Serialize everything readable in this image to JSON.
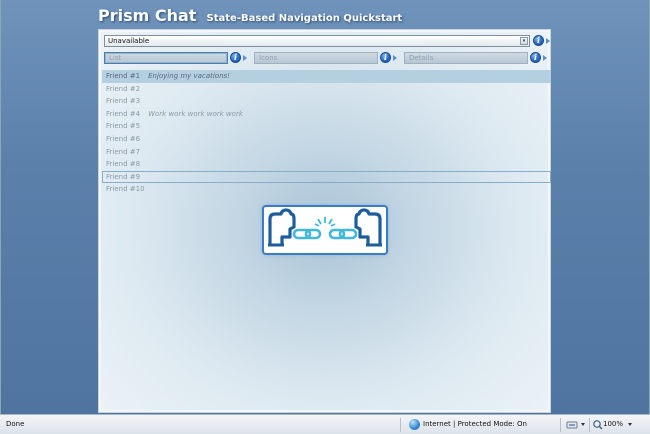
{
  "app": {
    "title": "Prism Chat",
    "subtitle": "State-Based Navigation Quickstart"
  },
  "status_select": {
    "value": "Unavailable",
    "arrow": "▾"
  },
  "tabs": [
    {
      "label": "List",
      "active": true
    },
    {
      "label": "Icons",
      "active": false
    },
    {
      "label": "Details",
      "active": false
    }
  ],
  "info_glyph": "i",
  "friends": [
    {
      "name": "Friend #1",
      "status": "Enjoying my vacations!",
      "selected": true,
      "focused": false
    },
    {
      "name": "Friend #2",
      "status": "",
      "selected": false,
      "focused": false
    },
    {
      "name": "Friend #3",
      "status": "",
      "selected": false,
      "focused": false
    },
    {
      "name": "Friend #4",
      "status": "Work work work work work",
      "selected": false,
      "focused": false
    },
    {
      "name": "Friend #5",
      "status": "",
      "selected": false,
      "focused": false
    },
    {
      "name": "Friend #6",
      "status": "",
      "selected": false,
      "focused": false
    },
    {
      "name": "Friend #7",
      "status": "",
      "selected": false,
      "focused": false
    },
    {
      "name": "Friend #8",
      "status": "",
      "selected": false,
      "focused": false
    },
    {
      "name": "Friend #9",
      "status": "",
      "selected": false,
      "focused": true
    },
    {
      "name": "Friend #10",
      "status": "",
      "selected": false,
      "focused": false
    }
  ],
  "statusbar": {
    "left": "Done",
    "zone": "Internet | Protected Mode: On",
    "zoom": "100%"
  },
  "colors": {
    "accent": "#2a6cc6",
    "logo_dark": "#1d5d9e",
    "logo_light": "#3fb8de"
  }
}
